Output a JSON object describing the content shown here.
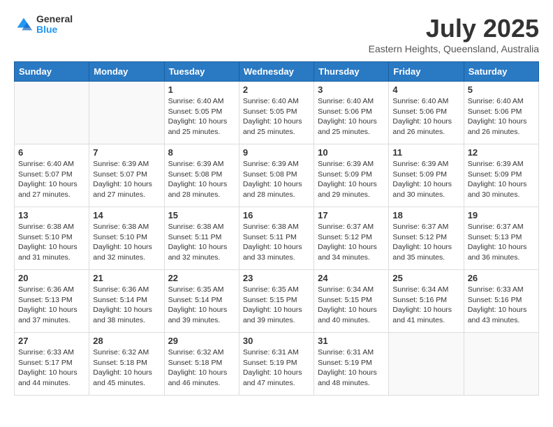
{
  "logo": {
    "general": "General",
    "blue": "Blue"
  },
  "title": {
    "month": "July 2025",
    "location": "Eastern Heights, Queensland, Australia"
  },
  "days_of_week": [
    "Sunday",
    "Monday",
    "Tuesday",
    "Wednesday",
    "Thursday",
    "Friday",
    "Saturday"
  ],
  "weeks": [
    [
      {
        "day": "",
        "info": ""
      },
      {
        "day": "",
        "info": ""
      },
      {
        "day": "1",
        "info": "Sunrise: 6:40 AM\nSunset: 5:05 PM\nDaylight: 10 hours\nand 25 minutes."
      },
      {
        "day": "2",
        "info": "Sunrise: 6:40 AM\nSunset: 5:05 PM\nDaylight: 10 hours\nand 25 minutes."
      },
      {
        "day": "3",
        "info": "Sunrise: 6:40 AM\nSunset: 5:06 PM\nDaylight: 10 hours\nand 25 minutes."
      },
      {
        "day": "4",
        "info": "Sunrise: 6:40 AM\nSunset: 5:06 PM\nDaylight: 10 hours\nand 26 minutes."
      },
      {
        "day": "5",
        "info": "Sunrise: 6:40 AM\nSunset: 5:06 PM\nDaylight: 10 hours\nand 26 minutes."
      }
    ],
    [
      {
        "day": "6",
        "info": "Sunrise: 6:40 AM\nSunset: 5:07 PM\nDaylight: 10 hours\nand 27 minutes."
      },
      {
        "day": "7",
        "info": "Sunrise: 6:39 AM\nSunset: 5:07 PM\nDaylight: 10 hours\nand 27 minutes."
      },
      {
        "day": "8",
        "info": "Sunrise: 6:39 AM\nSunset: 5:08 PM\nDaylight: 10 hours\nand 28 minutes."
      },
      {
        "day": "9",
        "info": "Sunrise: 6:39 AM\nSunset: 5:08 PM\nDaylight: 10 hours\nand 28 minutes."
      },
      {
        "day": "10",
        "info": "Sunrise: 6:39 AM\nSunset: 5:09 PM\nDaylight: 10 hours\nand 29 minutes."
      },
      {
        "day": "11",
        "info": "Sunrise: 6:39 AM\nSunset: 5:09 PM\nDaylight: 10 hours\nand 30 minutes."
      },
      {
        "day": "12",
        "info": "Sunrise: 6:39 AM\nSunset: 5:09 PM\nDaylight: 10 hours\nand 30 minutes."
      }
    ],
    [
      {
        "day": "13",
        "info": "Sunrise: 6:38 AM\nSunset: 5:10 PM\nDaylight: 10 hours\nand 31 minutes."
      },
      {
        "day": "14",
        "info": "Sunrise: 6:38 AM\nSunset: 5:10 PM\nDaylight: 10 hours\nand 32 minutes."
      },
      {
        "day": "15",
        "info": "Sunrise: 6:38 AM\nSunset: 5:11 PM\nDaylight: 10 hours\nand 32 minutes."
      },
      {
        "day": "16",
        "info": "Sunrise: 6:38 AM\nSunset: 5:11 PM\nDaylight: 10 hours\nand 33 minutes."
      },
      {
        "day": "17",
        "info": "Sunrise: 6:37 AM\nSunset: 5:12 PM\nDaylight: 10 hours\nand 34 minutes."
      },
      {
        "day": "18",
        "info": "Sunrise: 6:37 AM\nSunset: 5:12 PM\nDaylight: 10 hours\nand 35 minutes."
      },
      {
        "day": "19",
        "info": "Sunrise: 6:37 AM\nSunset: 5:13 PM\nDaylight: 10 hours\nand 36 minutes."
      }
    ],
    [
      {
        "day": "20",
        "info": "Sunrise: 6:36 AM\nSunset: 5:13 PM\nDaylight: 10 hours\nand 37 minutes."
      },
      {
        "day": "21",
        "info": "Sunrise: 6:36 AM\nSunset: 5:14 PM\nDaylight: 10 hours\nand 38 minutes."
      },
      {
        "day": "22",
        "info": "Sunrise: 6:35 AM\nSunset: 5:14 PM\nDaylight: 10 hours\nand 39 minutes."
      },
      {
        "day": "23",
        "info": "Sunrise: 6:35 AM\nSunset: 5:15 PM\nDaylight: 10 hours\nand 39 minutes."
      },
      {
        "day": "24",
        "info": "Sunrise: 6:34 AM\nSunset: 5:15 PM\nDaylight: 10 hours\nand 40 minutes."
      },
      {
        "day": "25",
        "info": "Sunrise: 6:34 AM\nSunset: 5:16 PM\nDaylight: 10 hours\nand 41 minutes."
      },
      {
        "day": "26",
        "info": "Sunrise: 6:33 AM\nSunset: 5:16 PM\nDaylight: 10 hours\nand 43 minutes."
      }
    ],
    [
      {
        "day": "27",
        "info": "Sunrise: 6:33 AM\nSunset: 5:17 PM\nDaylight: 10 hours\nand 44 minutes."
      },
      {
        "day": "28",
        "info": "Sunrise: 6:32 AM\nSunset: 5:18 PM\nDaylight: 10 hours\nand 45 minutes."
      },
      {
        "day": "29",
        "info": "Sunrise: 6:32 AM\nSunset: 5:18 PM\nDaylight: 10 hours\nand 46 minutes."
      },
      {
        "day": "30",
        "info": "Sunrise: 6:31 AM\nSunset: 5:19 PM\nDaylight: 10 hours\nand 47 minutes."
      },
      {
        "day": "31",
        "info": "Sunrise: 6:31 AM\nSunset: 5:19 PM\nDaylight: 10 hours\nand 48 minutes."
      },
      {
        "day": "",
        "info": ""
      },
      {
        "day": "",
        "info": ""
      }
    ]
  ]
}
